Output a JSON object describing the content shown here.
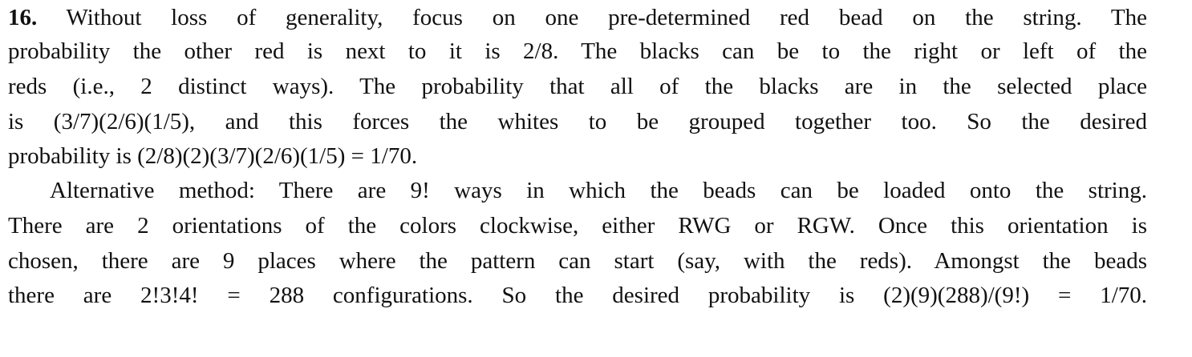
{
  "problem": {
    "number": "16.",
    "paragraph1": [
      " Without loss of generality, focus on one pre-determined red bead on the string. The",
      "probability the other red is next to it is 2/8. The blacks can be to the right or left of the",
      "reds (i.e., 2 distinct ways). The probability that all of the blacks are in the selected place",
      "is (3/7)(2/6)(1/5), and this forces the whites to be grouped together too. So the desired",
      "probability is (2/8)(2)(3/7)(2/6)(1/5) = 1/70."
    ],
    "paragraph2": [
      "Alternative method: There are 9! ways in which the beads can be loaded onto the string.",
      "There are 2 orientations of the colors clockwise, either RWG or RGW. Once this orientation is",
      "chosen, there are 9 places where the pattern can start (say, with the reds). Amongst the beads",
      "there are 2!3!4! = 288 configurations. So the desired probability is (2)(9)(288)/(9!) = 1/70."
    ]
  }
}
